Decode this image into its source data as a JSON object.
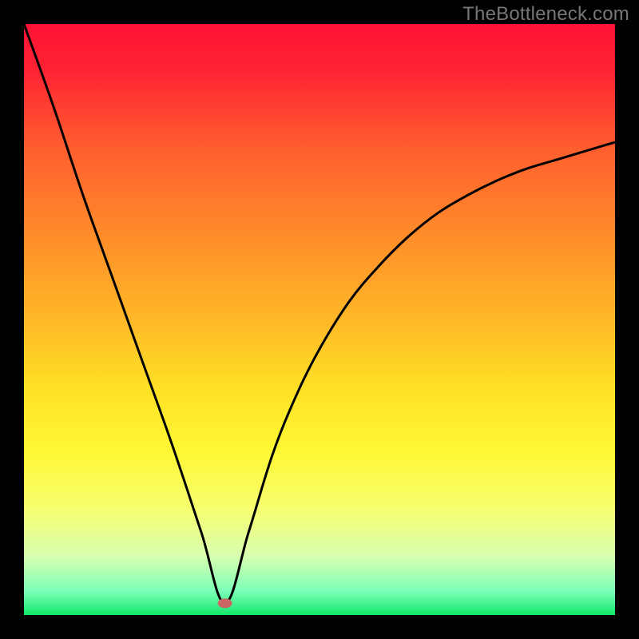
{
  "meta": {
    "watermark_text": "TheBottleneck.com"
  },
  "chart_data": {
    "type": "line",
    "title": "",
    "xlabel": "",
    "ylabel": "",
    "xlim": [
      0,
      100
    ],
    "ylim": [
      0,
      100
    ],
    "notes": "V-shaped curve over a vertical rainbow gradient (red→orange→yellow→green). Minimum near x≈34 where value≈2. Right branch rises with diminishing slope.",
    "series": [
      {
        "name": "curve",
        "x": [
          0,
          5,
          10,
          15,
          20,
          25,
          30,
          34,
          38,
          42,
          46,
          50,
          55,
          60,
          65,
          70,
          75,
          80,
          85,
          90,
          95,
          100
        ],
        "values": [
          100,
          86,
          71,
          57,
          43,
          29,
          14,
          2,
          14,
          27,
          37,
          45,
          53,
          59,
          64,
          68,
          71,
          73.5,
          75.5,
          77,
          78.5,
          80
        ]
      }
    ],
    "marker": {
      "x": 34,
      "y": 2,
      "color": "#cc6666"
    },
    "gradient_stops": [
      {
        "offset": 0,
        "color": "#ff1236"
      },
      {
        "offset": 8,
        "color": "#ff2433"
      },
      {
        "offset": 20,
        "color": "#ff5a2f"
      },
      {
        "offset": 35,
        "color": "#ff8a2a"
      },
      {
        "offset": 50,
        "color": "#ffb827"
      },
      {
        "offset": 62,
        "color": "#ffe226"
      },
      {
        "offset": 72,
        "color": "#fff733"
      },
      {
        "offset": 82,
        "color": "#f7ff70"
      },
      {
        "offset": 90,
        "color": "#d8ffb0"
      },
      {
        "offset": 96,
        "color": "#7cffb8"
      },
      {
        "offset": 100,
        "color": "#12e86a"
      }
    ]
  }
}
